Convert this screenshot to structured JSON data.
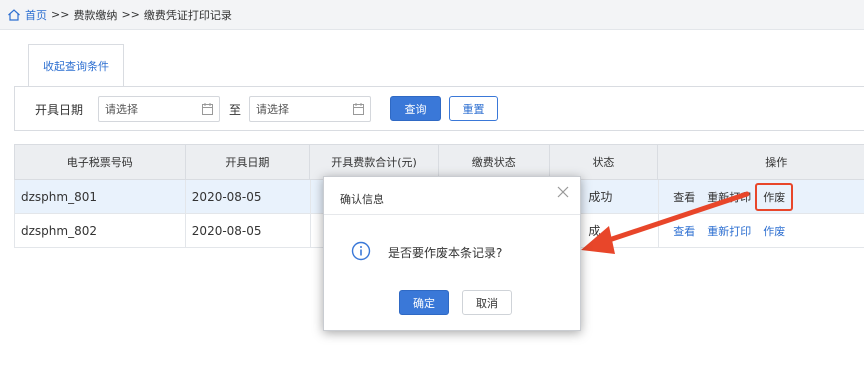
{
  "breadcrumb": {
    "home": "首页",
    "sep1": ">>",
    "level1": "费款缴纳",
    "sep2": ">>",
    "current": "缴费凭证打印记录"
  },
  "tab": {
    "label": "收起查询条件"
  },
  "filter": {
    "label": "开具日期",
    "start_placeholder": "请选择",
    "to": "至",
    "end_placeholder": "请选择",
    "query_button": "查询",
    "reset_button": "重置"
  },
  "table": {
    "columns": [
      "电子税票号码",
      "开具日期",
      "开具费款合计(元)",
      "缴费状态",
      "状态",
      "操作"
    ],
    "rows": [
      {
        "ticket_no": "dzsphm_801",
        "date": "2020-08-05",
        "status_partial": "成功",
        "actions": [
          "查看",
          "重新打印",
          "作废"
        ]
      },
      {
        "ticket_no": "dzsphm_802",
        "date": "2020-08-05",
        "status_partial": "成",
        "actions": [
          "查看",
          "重新打印",
          "作废"
        ]
      }
    ]
  },
  "dialog": {
    "title": "确认信息",
    "message": "是否要作废本条记录?",
    "ok": "确定",
    "cancel": "取消"
  },
  "colors": {
    "accent": "#3a78d8",
    "highlight": "#e8462a"
  }
}
